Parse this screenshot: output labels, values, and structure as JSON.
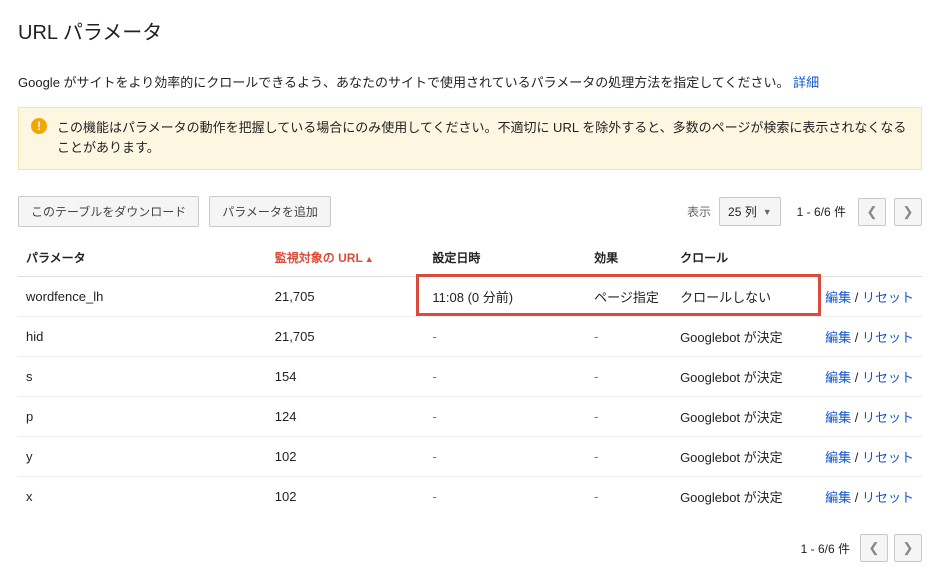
{
  "title": "URL パラメータ",
  "description": "Google がサイトをより効率的にクロールできるよう、あなたのサイトで使用されているパラメータの処理方法を指定してください。",
  "description_link": "詳細",
  "warning": "この機能はパラメータの動作を把握している場合にのみ使用してください。不適切に URL を除外すると、多数のページが検索に表示されなくなることがあります。",
  "toolbar": {
    "download_label": "このテーブルをダウンロード",
    "add_param_label": "パラメータを追加",
    "show_label": "表示",
    "rows_value": "25 列"
  },
  "pager": "1 - 6/6 件",
  "columns": {
    "param": "パラメータ",
    "urls": "監視対象の URL",
    "set_at": "設定日時",
    "effect": "効果",
    "crawl": "クロール",
    "actions": ""
  },
  "action_labels": {
    "edit": "編集",
    "reset": "リセット",
    "sep": " / "
  },
  "rows": [
    {
      "param": "wordfence_lh",
      "urls": "21,705",
      "set_at": "11:08 (0 分前)",
      "effect": "ページ指定",
      "crawl": "クロールしない",
      "highlight": true
    },
    {
      "param": "hid",
      "urls": "21,705",
      "set_at": "-",
      "effect": "-",
      "crawl": "Googlebot が決定",
      "highlight": false
    },
    {
      "param": "s",
      "urls": "154",
      "set_at": "-",
      "effect": "-",
      "crawl": "Googlebot が決定",
      "highlight": false
    },
    {
      "param": "p",
      "urls": "124",
      "set_at": "-",
      "effect": "-",
      "crawl": "Googlebot が決定",
      "highlight": false
    },
    {
      "param": "y",
      "urls": "102",
      "set_at": "-",
      "effect": "-",
      "crawl": "Googlebot が決定",
      "highlight": false
    },
    {
      "param": "x",
      "urls": "102",
      "set_at": "-",
      "effect": "-",
      "crawl": "Googlebot が決定",
      "highlight": false
    }
  ]
}
